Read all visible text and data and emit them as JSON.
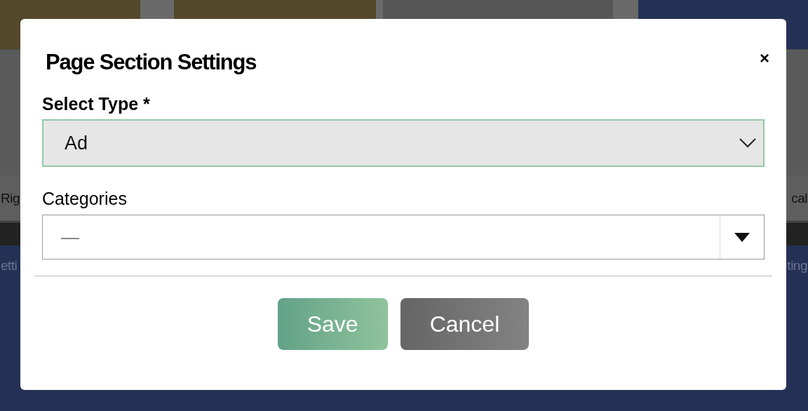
{
  "background": {
    "left_texts": [
      "Rig",
      "etti"
    ],
    "right_texts": [
      "cal",
      "ting"
    ]
  },
  "dialog": {
    "title": "Page Section Settings",
    "close": "×",
    "fields": [
      {
        "kind": "select",
        "label": "Select Type *",
        "value": "Ad",
        "focused": true
      },
      {
        "kind": "combo",
        "label": "Categories",
        "value": "—",
        "focused": false
      }
    ],
    "buttons": [
      {
        "kind": "primary",
        "label": "Save"
      },
      {
        "kind": "secondary",
        "label": "Cancel"
      }
    ]
  }
}
